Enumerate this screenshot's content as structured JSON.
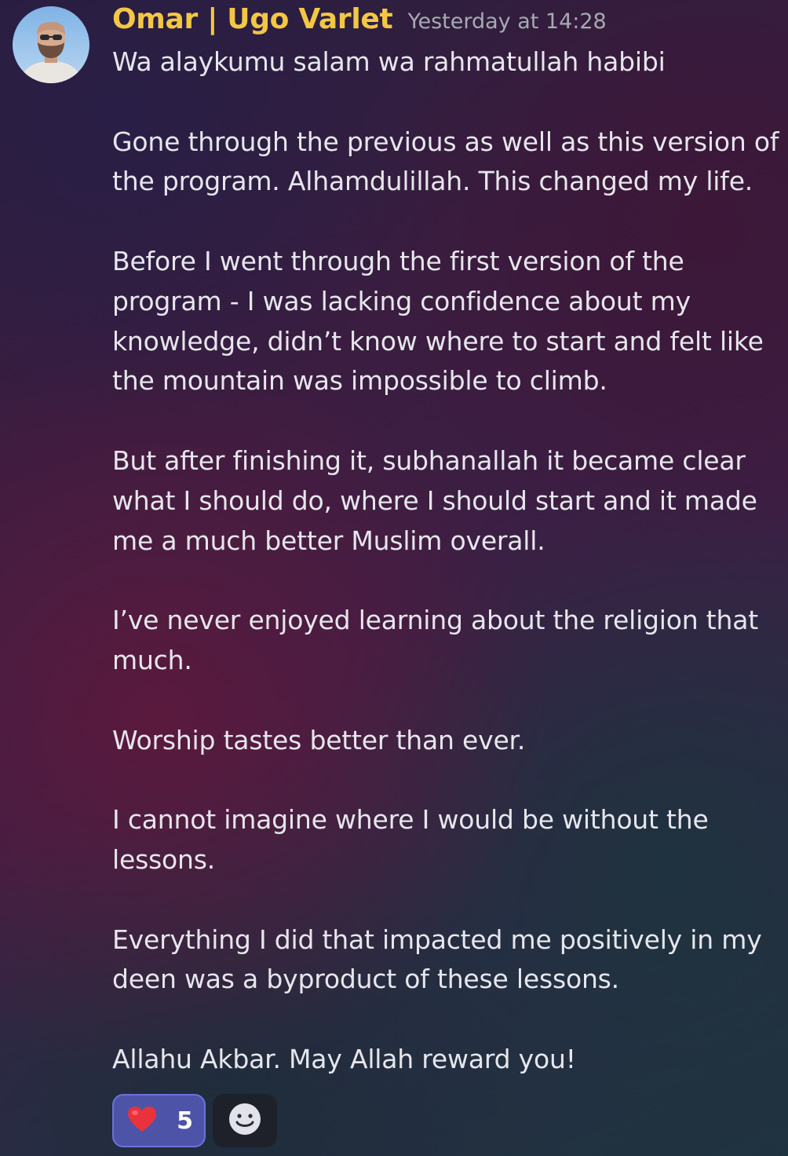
{
  "author": {
    "name": "Omar | Ugo Varlet",
    "timestamp": "Yesterday at 14:28",
    "name_color": "#f2c744"
  },
  "message": {
    "paragraphs": [
      "Wa alaykumu salam wa rahmatullah habibi",
      "Gone through the previous as well as this version of the program. Alhamdulillah. This changed my life.",
      "Before I went through the first version of the program - I was lacking confidence about my knowledge, didn’t know where to start and felt like the mountain was impossible to climb.",
      "But after finishing it, subhanallah it became clear what I should do, where I should start and it made me a much better Muslim overall.",
      "I’ve never enjoyed learning about the religion that much.",
      "Worship tastes better than ever.",
      "I cannot imagine where I would be without the lessons.",
      "Everything I did that impacted me positively in my deen was a byproduct of these lessons.",
      "Allahu Akbar. May Allah reward you!"
    ]
  },
  "reactions": [
    {
      "icon": "heart-icon",
      "count": "5",
      "active": true
    },
    {
      "icon": "add-reaction-icon"
    }
  ]
}
